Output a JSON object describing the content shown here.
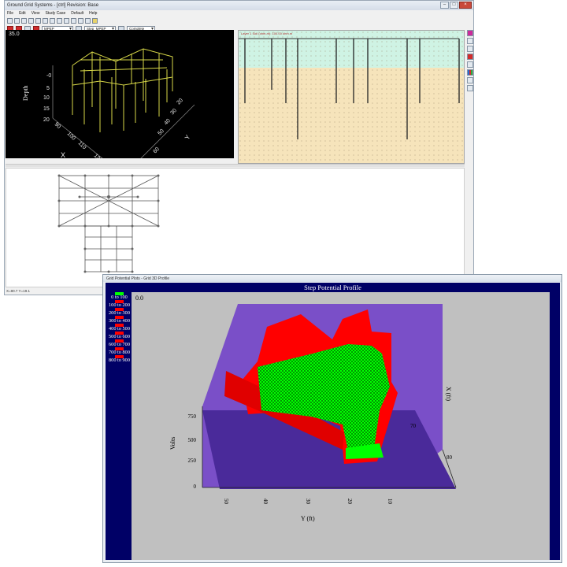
{
  "main_window": {
    "title": "Ground Grid Systems - [ctrl]   Revision: Base",
    "menu": [
      "File",
      "Edit",
      "View",
      "Study Case",
      "Default",
      "Help"
    ],
    "toolbar2": {
      "dropdown_1": "MPEP",
      "dropdown_2": "Step_MPEP",
      "dropdown_3": "Complete"
    },
    "view3d": {
      "depth_readout": "35.0",
      "depth_label": "Depth",
      "depth_ticks": [
        "-0",
        "5",
        "10",
        "15",
        "20"
      ],
      "x_label": "X",
      "x_ticks": [
        "90",
        "100",
        "110",
        "120",
        "130"
      ],
      "y_label": "Y",
      "y_ticks": [
        "20",
        "30",
        "40",
        "50",
        "60",
        "70"
      ]
    },
    "soil_label": "Layer 1 Soil (ohm-m): 100.00 ohm.m",
    "status": "X=80.7   Y=19.1"
  },
  "step_window": {
    "title": "Grid Potential Plots - Grid 3D Profile",
    "chart": {
      "title": "Step Potential Profile",
      "corner_value": "0.0",
      "z_label": "Volts",
      "z_ticks": [
        "0",
        "250",
        "500",
        "750"
      ],
      "y_label": "Y (ft)",
      "y_ticks": [
        "50",
        "40",
        "30",
        "20",
        "10"
      ],
      "x_label": "X (ft)",
      "x_ticks": [
        "70",
        "80"
      ],
      "legend": [
        {
          "label": "0 to 100",
          "color": "#00ff00"
        },
        {
          "label": "100 to 200",
          "color": "#ff0000"
        },
        {
          "label": "200 to 300",
          "color": "#ff0000"
        },
        {
          "label": "300 to 400",
          "color": "#ff0000"
        },
        {
          "label": "400 to 500",
          "color": "#ff0000"
        },
        {
          "label": "500 to 600",
          "color": "#ff0000"
        },
        {
          "label": "600 to 700",
          "color": "#ff0000"
        },
        {
          "label": "700 to 800",
          "color": "#ff0000"
        },
        {
          "label": "800 to 900",
          "color": "#ff0000"
        }
      ]
    }
  },
  "colors": {
    "grid3d_lines": "#d8d848",
    "soil_top": "#cff3e4",
    "soil_bottom": "#f6e4bb",
    "surface_green": "#00ff00",
    "surface_red": "#ff0000",
    "floor_purple": "#4a2a9a",
    "wall_purple": "#7a4fc8"
  }
}
